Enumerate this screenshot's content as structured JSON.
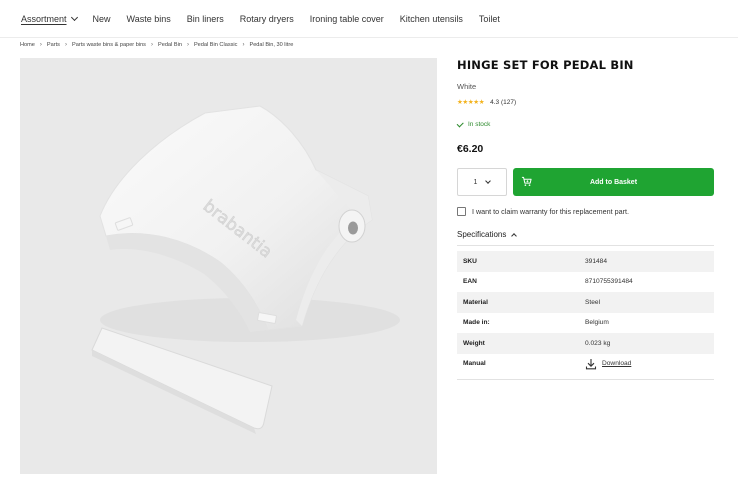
{
  "nav": {
    "items": [
      {
        "label": "Assortment"
      },
      {
        "label": "New"
      },
      {
        "label": "Waste bins"
      },
      {
        "label": "Bin liners"
      },
      {
        "label": "Rotary dryers"
      },
      {
        "label": "Ironing table cover"
      },
      {
        "label": "Kitchen utensils"
      },
      {
        "label": "Toilet"
      }
    ]
  },
  "breadcrumb": [
    "Home",
    "Parts",
    "Parts waste bins & paper bins",
    "Pedal Bin",
    "Pedal Bin Classic",
    "Pedal Bin, 30 litre"
  ],
  "product": {
    "title": "HINGE SET FOR PEDAL BIN",
    "variant": "White",
    "rating": "4.3 (127)",
    "rating_value": 4.3,
    "rating_max": 5,
    "stock": "In stock",
    "price": "€6.20",
    "brand_mark": "brabantia",
    "quantity": "1",
    "add_to_basket": "Add to Basket",
    "warranty_label": "I want to claim warranty for this replacement part.",
    "warranty_checked": false
  },
  "specs": {
    "header": "Specifications",
    "rows": [
      {
        "key": "SKU",
        "value": "391484"
      },
      {
        "key": "EAN",
        "value": "8710755391484"
      },
      {
        "key": "Material",
        "value": "Steel"
      },
      {
        "key": "Made in:",
        "value": "Belgium"
      },
      {
        "key": "Weight",
        "value": "0.023 kg"
      },
      {
        "key": "Manual",
        "value": "Download"
      }
    ]
  },
  "colors": {
    "accent_green": "#1fa432",
    "stock_green": "#2e8b2e",
    "star_yellow": "#f3b21b",
    "image_background": "#e9e9e9"
  },
  "icons": [
    "chevron-down-icon",
    "chevron-right-icon",
    "star-icon",
    "check-icon",
    "cart-icon",
    "chevron-up-icon",
    "download-icon"
  ]
}
